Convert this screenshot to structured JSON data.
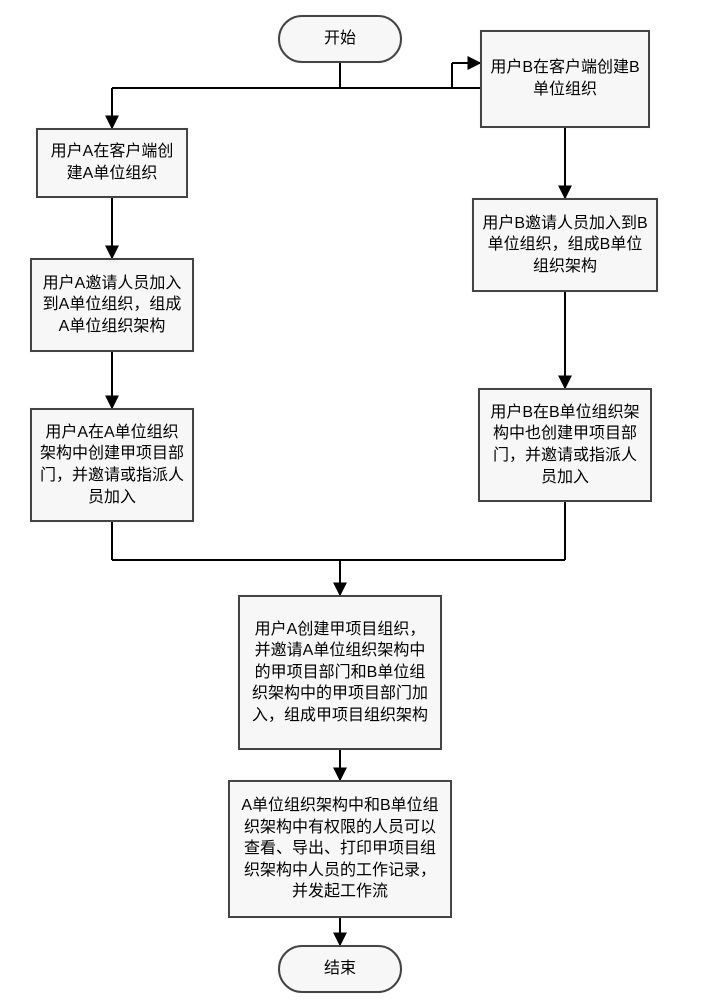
{
  "chart_data": {
    "type": "flowchart",
    "nodes": [
      {
        "id": "start",
        "shape": "terminator",
        "text": "开始"
      },
      {
        "id": "b_create",
        "shape": "process",
        "text": "用户B在客户端创建B单位组织"
      },
      {
        "id": "a_create",
        "shape": "process",
        "text": "用户A在客户端创建A单位组织"
      },
      {
        "id": "b_invite",
        "shape": "process",
        "text": "用户B邀请人员加入到B单位组织，组成B单位组织架构"
      },
      {
        "id": "a_invite",
        "shape": "process",
        "text": "用户A邀请人员加入到A单位组织，组成A单位组织架构"
      },
      {
        "id": "a_proj_dept",
        "shape": "process",
        "text": "用户A在A单位组织架构中创建甲项目部门，并邀请或指派人员加入"
      },
      {
        "id": "b_proj_dept",
        "shape": "process",
        "text": "用户B在B单位组织架构中也创建甲项目部门，并邀请或指派人员加入"
      },
      {
        "id": "merge",
        "shape": "process",
        "text": "用户A创建甲项目组织，并邀请A单位组织架构中的甲项目部门和B单位组织架构中的甲项目部门加入，组成甲项目组织架构"
      },
      {
        "id": "result",
        "shape": "process",
        "text": "A单位组织架构中和B单位组织架构中有权限的人员可以查看、导出、打印甲项目组织架构中人员的工作记录，并发起工作流"
      },
      {
        "id": "end",
        "shape": "terminator",
        "text": "结束"
      }
    ],
    "edges": [
      {
        "from": "start",
        "to": "a_create"
      },
      {
        "from": "start",
        "to": "b_create"
      },
      {
        "from": "a_create",
        "to": "a_invite"
      },
      {
        "from": "b_create",
        "to": "b_invite"
      },
      {
        "from": "a_invite",
        "to": "a_proj_dept"
      },
      {
        "from": "b_invite",
        "to": "b_proj_dept"
      },
      {
        "from": "a_proj_dept",
        "to": "merge"
      },
      {
        "from": "b_proj_dept",
        "to": "merge"
      },
      {
        "from": "merge",
        "to": "result"
      },
      {
        "from": "result",
        "to": "end"
      }
    ]
  }
}
